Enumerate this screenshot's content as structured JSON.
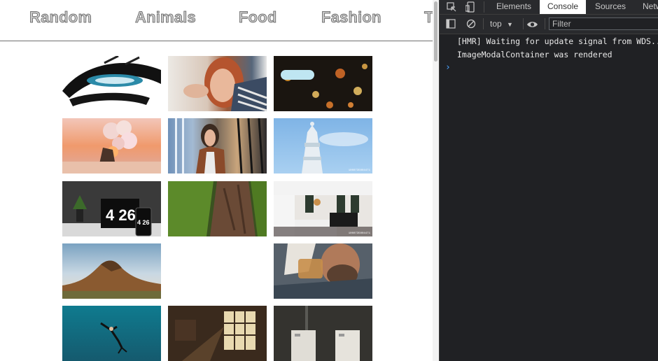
{
  "nav": {
    "items": [
      {
        "label": "Random"
      },
      {
        "label": "Animals"
      },
      {
        "label": "Food"
      },
      {
        "label": "Fashion"
      },
      {
        "label": "Tr"
      }
    ]
  },
  "gallery": {
    "images": [
      {
        "subject": "eye line drawing"
      },
      {
        "subject": "red-haired woman portrait"
      },
      {
        "subject": "night bokeh lights"
      },
      {
        "subject": "balloons at sunset"
      },
      {
        "subject": "woman with jacket"
      },
      {
        "subject": "tower against blue sky",
        "watermark": "1000735004471"
      },
      {
        "subject": "laptop and phone clock 4 26",
        "clock_big": "4 26",
        "clock_small": "4 26"
      },
      {
        "subject": "mossy tree trunk"
      },
      {
        "subject": "modern kitchen",
        "watermark": "1000735004471"
      },
      {
        "subject": "mountain landscape"
      },
      {
        "subject": "empty"
      },
      {
        "subject": "man drinking whisky"
      },
      {
        "subject": "diver underwater"
      },
      {
        "subject": "room with window light"
      },
      {
        "subject": "two white doors"
      }
    ]
  },
  "devtools": {
    "tabs": [
      {
        "label": "Elements"
      },
      {
        "label": "Console",
        "active": true
      },
      {
        "label": "Sources"
      },
      {
        "label": "Netw"
      }
    ],
    "context": "top",
    "filter_placeholder": "Filter",
    "messages": [
      {
        "text": "[HMR] Waiting for update signal from WDS..."
      },
      {
        "text": "ImageModalContainer was rendered"
      }
    ],
    "prompt": "›",
    "icons": {
      "inspect": "inspect-element-icon",
      "device": "device-toolbar-icon",
      "sidebar": "show-sidebar-icon",
      "clear": "clear-console-icon",
      "dropdown": "chevron-down-icon",
      "eye": "live-expression-eye-icon"
    },
    "colors": {
      "background": "#202124",
      "accent": "#4aa3ff"
    }
  }
}
